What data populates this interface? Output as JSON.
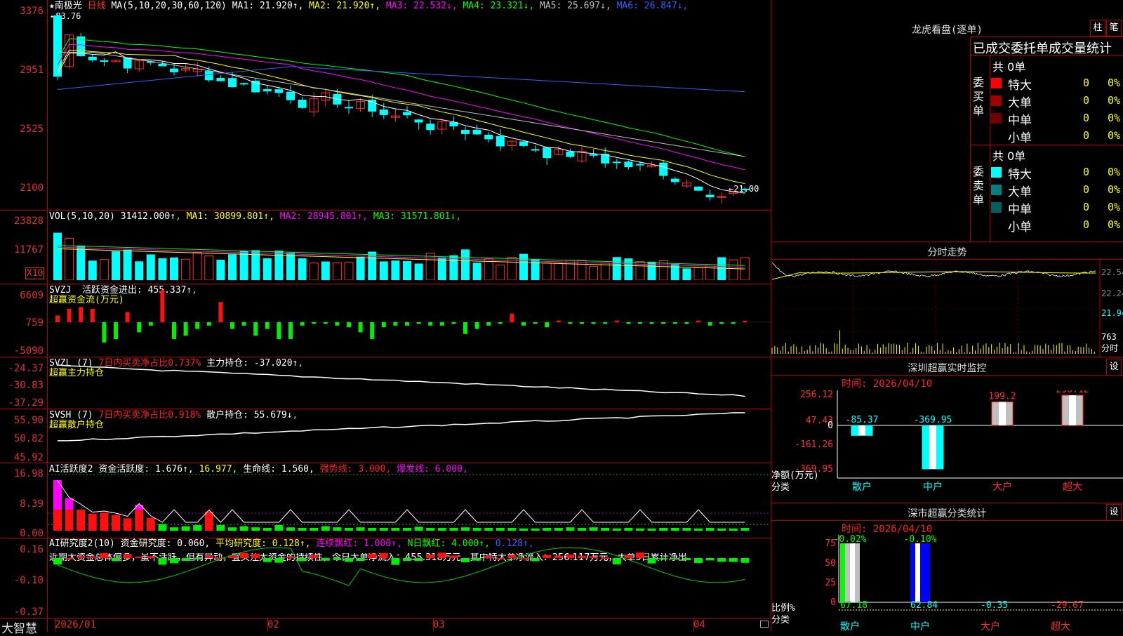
{
  "stock": {
    "title_star": "★",
    "name": "南极光",
    "period": "日线",
    "high_mark": "83.76",
    "low_mark": "21.00"
  },
  "ma_line": {
    "label": "MA(5,10,20,30,60,120)",
    "items": [
      {
        "text": "MA1: 21.920↑",
        "color": "#ffffff"
      },
      {
        "text": "MA2: 21.920↑",
        "color": "#ffff00"
      },
      {
        "text": "MA3: 22.532↓",
        "color": "#ff00ff"
      },
      {
        "text": "MA4: 23.321↓",
        "color": "#00ff00"
      },
      {
        "text": "MA5: 25.697↓",
        "color": "#c0c0c0"
      },
      {
        "text": "MA6: 26.847↓",
        "color": "#3060ff"
      }
    ]
  },
  "price_axis": [
    "3376",
    "2951",
    "2525",
    "2100"
  ],
  "vol_panel": {
    "label": "VOL(5,10,20)",
    "value": "31412.000↑",
    "items": [
      {
        "text": "MA1: 30899.801↑",
        "color": "#ffff00"
      },
      {
        "text": "MA2: 28945.801↑",
        "color": "#ff00ff"
      },
      {
        "text": "MA3: 31571.801↓",
        "color": "#00ff00"
      }
    ],
    "axis": [
      "23828",
      "11767"
    ],
    "unit": "X10"
  },
  "svzj_panel": {
    "label": "SVZJ",
    "text1": "活跃资金进出: 455.337↑",
    "text2": "超赢资金流(万元)",
    "axis": [
      "6609",
      "759",
      "-5090"
    ]
  },
  "svzl_panel": {
    "label": "SVZL (7)",
    "text_red": "7日内买卖净占比0.737%",
    "text_white": "主力持仓: -37.020↑",
    "text2": "超赢主力持仓",
    "axis": [
      "-24.37",
      "-30.83",
      "-37.29"
    ]
  },
  "svsh_panel": {
    "label": "SVSH (7)",
    "text_red": "7日内买卖净占比0.918%",
    "text_white": "散户持仓: 55.679↓",
    "text2": "超赢散户持仓",
    "axis": [
      "55.90",
      "50.82",
      "45.92"
    ]
  },
  "ai_active": {
    "label": "AI活跃度2",
    "items": [
      {
        "text": "资金活跃度: 1.676↑",
        "color": "#ffffff"
      },
      {
        "text": "16.977",
        "color": "#ffff00"
      },
      {
        "text": "生命线: 1.560",
        "color": "#ffffff"
      },
      {
        "text": "强势线: 3.000",
        "color": "#ff2020"
      },
      {
        "text": "爆发线: 6.000",
        "color": "#ff00ff"
      }
    ],
    "axis": [
      "16.98",
      "8.39",
      "0.00"
    ]
  },
  "ai_research": {
    "label": "AI研究度2(10)",
    "items": [
      {
        "text": "资金研究度: 0.060",
        "color": "#ffffff"
      },
      {
        "text": "平均研究度: 0.128↑",
        "color": "#ffff00"
      },
      {
        "text": "连续飘红: 1.000↑",
        "color": "#ff00ff"
      },
      {
        "text": "N日飘红: 4.000↑",
        "color": "#00ff00"
      },
      {
        "text": "0.128↑",
        "color": "#3060ff"
      }
    ],
    "comment": "近期大资金总体偏多，虽不活跃，但有异动，宜关注大资金的持续性，今日大单净流入：455.318万元，其中特大单净流入：256.117万元，大单5日累计净出",
    "axis": [
      "0.16",
      "-0.10",
      "-0.37"
    ]
  },
  "date_axis": [
    "2026/01",
    "02",
    "03",
    "04"
  ],
  "brand": "大智慧",
  "dragon_tiger": {
    "title": "龙虎看盘(逐单)",
    "btn1": "柱",
    "btn2": "笔",
    "subtitle": "已成交委托单成交量统计",
    "buy": {
      "side_label": "委买单",
      "total": "共 0单",
      "rows": [
        {
          "label": "特大",
          "val": "0",
          "pct": "0%",
          "color": "#ff0000"
        },
        {
          "label": "大单",
          "val": "0",
          "pct": "0%",
          "color": "#a00000"
        },
        {
          "label": "中单",
          "val": "0",
          "pct": "0%",
          "color": "#700000"
        },
        {
          "label": "小单",
          "val": "0",
          "pct": "0%",
          "color": ""
        }
      ]
    },
    "sell": {
      "side_label": "委卖单",
      "total": "共 0单",
      "rows": [
        {
          "label": "特大",
          "val": "0",
          "pct": "0%",
          "color": "#00ffff"
        },
        {
          "label": "大单",
          "val": "0",
          "pct": "0%",
          "color": "#008080"
        },
        {
          "label": "中单",
          "val": "0",
          "pct": "0%",
          "color": "#006060"
        },
        {
          "label": "小单",
          "val": "0",
          "pct": "0%",
          "color": ""
        }
      ]
    }
  },
  "intraday": {
    "title": "分时走势",
    "axis": [
      "22.54",
      "22.24",
      "21.94"
    ],
    "vol_axis": [
      "763",
      "分时"
    ]
  },
  "sz_monitor": {
    "title": "深圳超赢实时监控",
    "btn": "设",
    "time": "时间: 2026/04/10",
    "axis": [
      "256.12",
      "47.43",
      "0",
      "-161.26",
      "-369.95"
    ],
    "ylabel1": "净额(万元)",
    "ylabel2": "分类",
    "categories": [
      "散户",
      "中户",
      "大户",
      "超大"
    ],
    "values": [
      "-85.37",
      "-369.95",
      "199.2",
      "256.12"
    ]
  },
  "sz_class": {
    "title": "深市超赢分类统计",
    "btn": "设",
    "time": "时间: 2026/04/10",
    "axis": [
      "75",
      "50",
      "25",
      "0"
    ],
    "ylabel1": "比例%",
    "ylabel2": "分类",
    "categories": [
      "散户",
      "中户",
      "大户",
      "超大"
    ],
    "top_values": [
      "-0.02%",
      "-0.10%"
    ],
    "bottom_values": [
      "67.18",
      "62.84",
      "-0.35",
      "-29.67"
    ]
  },
  "chart_data": {
    "type": "candlestick",
    "title": "南极光 日线",
    "x_labels": [
      "2026/01",
      "02",
      "03",
      "04"
    ],
    "ylim": [
      21.0,
      33.76
    ],
    "ma": {
      "MA1": 21.92,
      "MA2": 21.92,
      "MA3": 22.532,
      "MA4": 23.321,
      "MA5": 25.697,
      "MA6": 26.847
    },
    "volume": {
      "VOL": 31412.0,
      "MA1": 30899.801,
      "MA2": 28945.801,
      "MA3": 31571.801
    },
    "sz_monitor": {
      "categories": [
        "散户",
        "中户",
        "大户",
        "超大"
      ],
      "values": [
        -85.37,
        -369.95,
        199.2,
        256.12
      ]
    }
  }
}
